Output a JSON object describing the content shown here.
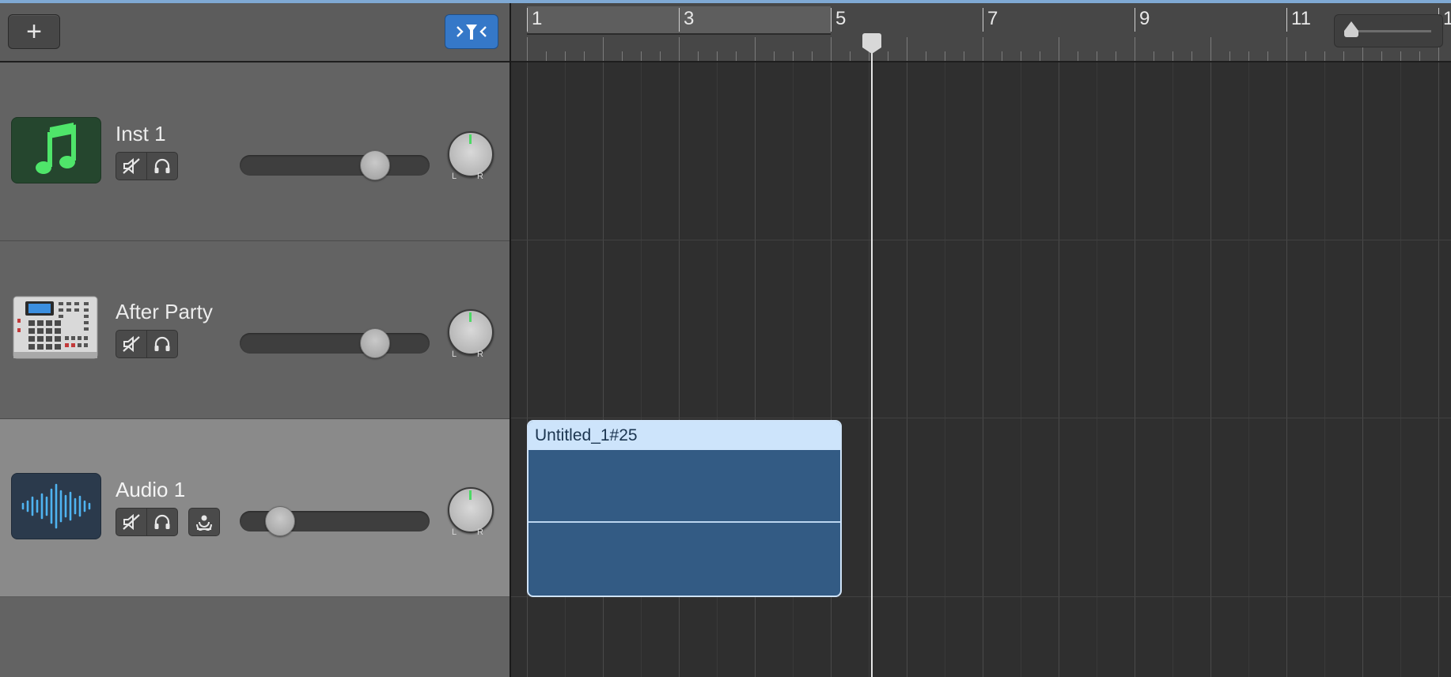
{
  "toolbar": {
    "add_icon": "plus-icon",
    "smart_icon": "smart-controls-filter-icon",
    "accent": "#3578c8"
  },
  "ruler": {
    "bars": [
      "1",
      "3",
      "5",
      "7",
      "9",
      "11",
      "1"
    ],
    "cycle_range": [
      1,
      5
    ],
    "playhead_bar": 5.5
  },
  "tracks": [
    {
      "name": "Inst 1",
      "icon": "music-note-icon",
      "volume": 0.72,
      "pan": 0,
      "pan_left": "L",
      "pan_right": "R",
      "mute_icon": "mute-speaker-icon",
      "solo_icon": "headphones-icon"
    },
    {
      "name": "After Party",
      "icon": "drum-machine-icon",
      "volume": 0.72,
      "pan": 0,
      "pan_left": "L",
      "pan_right": "R",
      "mute_icon": "mute-speaker-icon",
      "solo_icon": "headphones-icon"
    },
    {
      "name": "Audio 1",
      "icon": "waveform-icon",
      "volume": 0.21,
      "pan": 0,
      "pan_left": "L",
      "pan_right": "R",
      "mute_icon": "mute-speaker-icon",
      "solo_icon": "headphones-icon",
      "input_icon": "input-monitoring-icon",
      "selected": true
    }
  ],
  "regions": [
    {
      "name": "Untitled_1#25",
      "track": 2,
      "start_bar": 1,
      "end_bar": 5.1,
      "color": "#335b84"
    }
  ],
  "zoom": {
    "level": 0.05
  }
}
